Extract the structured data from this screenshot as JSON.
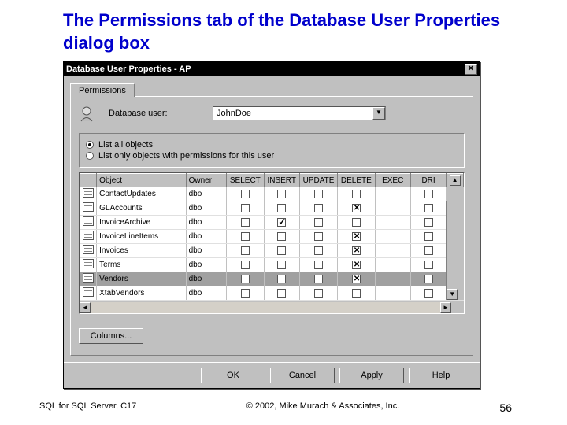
{
  "slide_title": "The Permissions tab of the Database User Properties dialog box",
  "dialog": {
    "title": "Database User Properties - AP",
    "tab_label": "Permissions",
    "user_label": "Database user:",
    "user_value": "JohnDoe",
    "radios": {
      "all": "List all objects",
      "only": "List only objects with permissions for this user",
      "selected": "all"
    },
    "columns": {
      "object": "Object",
      "owner": "Owner",
      "select": "SELECT",
      "insert": "INSERT",
      "update": "UPDATE",
      "delete": "DELETE",
      "exec": "EXEC",
      "dri": "DRI"
    },
    "rows": [
      {
        "object": "ContactUpdates",
        "owner": "dbo",
        "perms": {}
      },
      {
        "object": "GLAccounts",
        "owner": "dbo",
        "perms": {
          "delete": "x"
        }
      },
      {
        "object": "InvoiceArchive",
        "owner": "dbo",
        "perms": {
          "insert": "chk"
        }
      },
      {
        "object": "InvoiceLineItems",
        "owner": "dbo",
        "perms": {
          "delete": "x"
        }
      },
      {
        "object": "Invoices",
        "owner": "dbo",
        "perms": {
          "delete": "x"
        }
      },
      {
        "object": "Terms",
        "owner": "dbo",
        "perms": {
          "delete": "x"
        }
      },
      {
        "object": "Vendors",
        "owner": "dbo",
        "perms": {
          "delete": "x"
        },
        "selected": true
      },
      {
        "object": "XtabVendors",
        "owner": "dbo",
        "perms": {}
      }
    ],
    "columns_button": "Columns...",
    "buttons": {
      "ok": "OK",
      "cancel": "Cancel",
      "apply": "Apply",
      "help": "Help"
    }
  },
  "footer": {
    "left": "SQL for SQL Server, C17",
    "center": "© 2002, Mike Murach & Associates, Inc.",
    "right": "56"
  }
}
